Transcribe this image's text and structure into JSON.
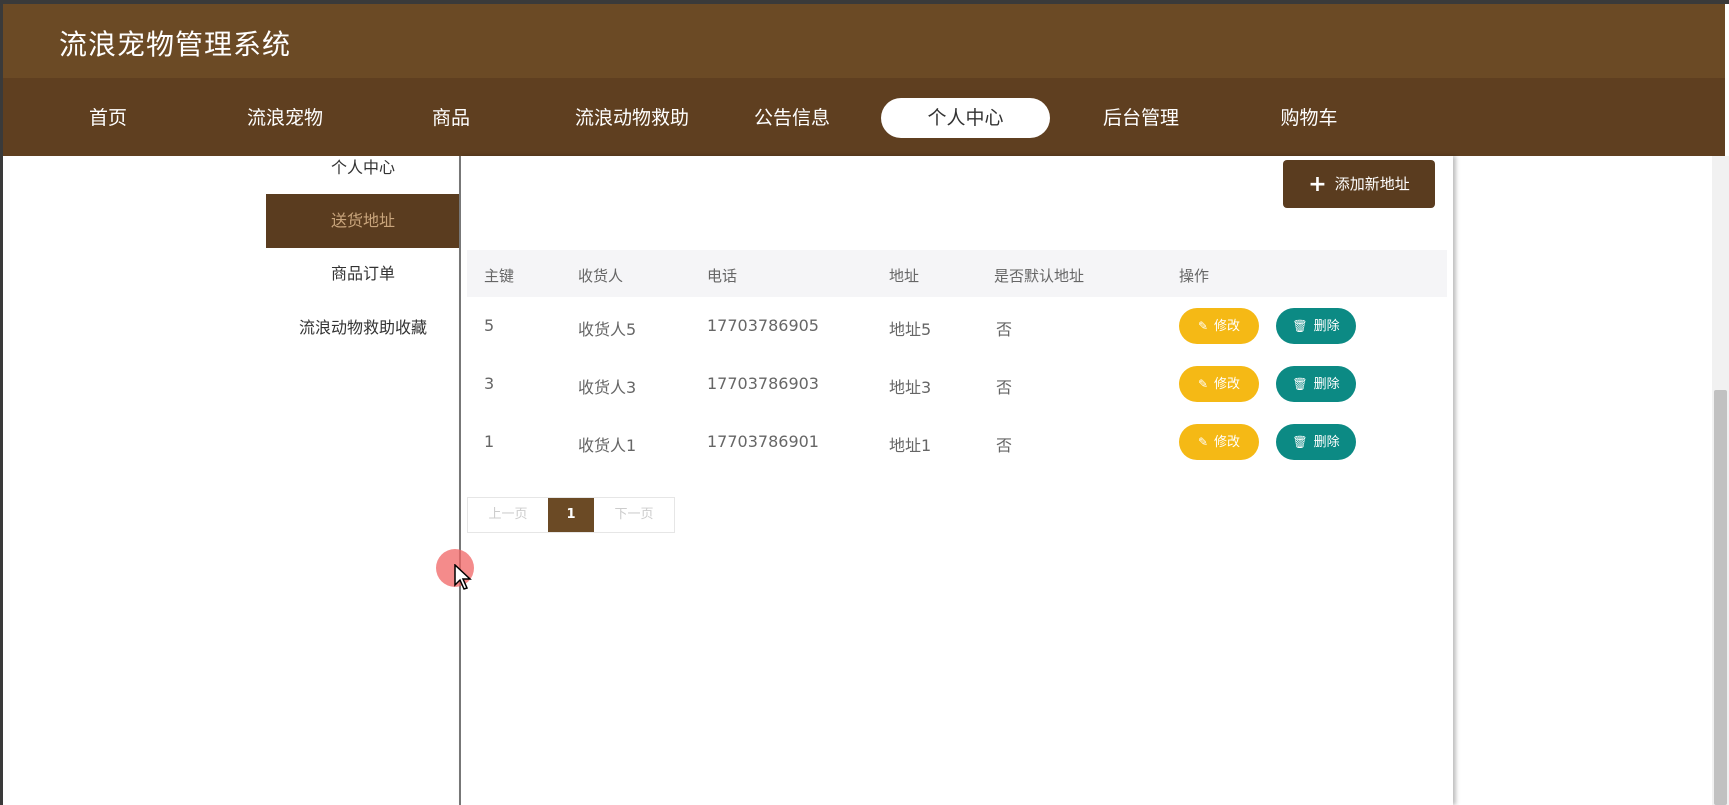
{
  "header": {
    "title": "流浪宠物管理系统"
  },
  "nav": {
    "items": [
      "首页",
      "流浪宠物",
      "商品",
      "流浪动物救助",
      "公告信息",
      "个人中心",
      "后台管理",
      "购物车"
    ],
    "active": "个人中心"
  },
  "sidebar": {
    "items": [
      "个人中心",
      "送货地址",
      "商品订单",
      "流浪动物救助收藏"
    ],
    "active": "送货地址"
  },
  "toolbar": {
    "add_label": "添加新地址",
    "add_icon": "plus-icon"
  },
  "table": {
    "columns": [
      "主键",
      "收货人",
      "电话",
      "地址",
      "是否默认地址",
      "操作"
    ],
    "rows": [
      {
        "id": "5",
        "receiver": "收货人5",
        "phone": "17703786905",
        "address": "地址5",
        "is_default": "否"
      },
      {
        "id": "3",
        "receiver": "收货人3",
        "phone": "17703786903",
        "address": "地址3",
        "is_default": "否"
      },
      {
        "id": "1",
        "receiver": "收货人1",
        "phone": "17703786901",
        "address": "地址1",
        "is_default": "否"
      }
    ],
    "edit_label": "修改",
    "delete_label": "删除",
    "edit_icon": "pencil-icon",
    "delete_icon": "trash-icon"
  },
  "pager": {
    "prev": "上一页",
    "current": "1",
    "next": "下一页"
  },
  "colors": {
    "header": "#6b4a25",
    "nav": "#5f3f20",
    "sidebar_active": "#5a3c1f",
    "edit_button": "#f5b915",
    "delete_button": "#0c8a84"
  }
}
